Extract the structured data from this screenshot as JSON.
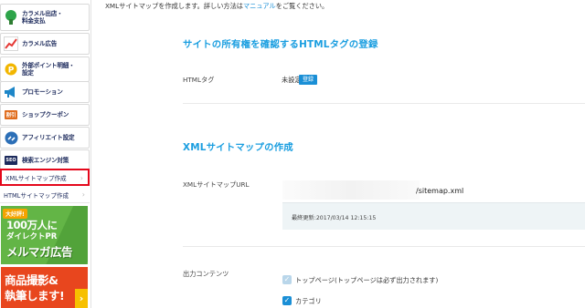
{
  "intro": {
    "before": "XMLサイトマップを作成します。詳しい方法は",
    "link": "マニュアル",
    "after": "をご覧ください。"
  },
  "sidebar": {
    "items": [
      {
        "label": "カラメル出店・\n料金支払",
        "icon": "shop-icon"
      },
      {
        "label": "カラメル広告",
        "icon": "chart-icon"
      },
      {
        "label": "外部ポイント明細・\n設定",
        "icon": "point-icon"
      },
      {
        "label": "プロモーション",
        "icon": "megaphone-icon"
      },
      {
        "label": "ショップクーポン",
        "icon": "coupon-icon",
        "icon_text": "割引"
      },
      {
        "label": "アフィリエイト設定",
        "icon": "link-icon"
      },
      {
        "label": "検索エンジン対策",
        "icon": "seo-icon",
        "icon_text": "SEO"
      }
    ],
    "sub_items": [
      {
        "label": "XMLサイトマップ作成",
        "active": true
      },
      {
        "label": "HTMLサイトマップ作成",
        "active": false
      }
    ],
    "chevron": "›",
    "ad_green": {
      "badge": "大好評!",
      "line1": "100万人に",
      "line2": "ダイレクトPR",
      "line3": "メルマガ広告"
    },
    "ad_orange": {
      "line1": "商品撮影&",
      "line2": "執筆します!",
      "arrow": "›"
    }
  },
  "html_tag_section": {
    "title": "サイトの所有権を確認するHTMLタグの登録",
    "label": "HTMLタグ",
    "status": "未設定",
    "button": "登録"
  },
  "xml_section": {
    "title": "XMLサイトマップの作成",
    "url_label": "XMLサイトマップURL",
    "url_suffix": "/sitemap.xml",
    "last_update": "最終更新:2017/03/14 12:15:15",
    "content_label": "出力コンテンツ",
    "checkboxes": [
      {
        "label": "トップページ(トップページは必ず出力されます)",
        "checked": true,
        "disabled": true
      },
      {
        "label": "カテゴリ",
        "checked": true,
        "disabled": false
      }
    ]
  },
  "colors": {
    "accent": "#1a9ee0",
    "link": "#1a8fd6",
    "active_border": "#e4071b",
    "ad_green": "#63b546",
    "ad_orange": "#e8461e"
  }
}
